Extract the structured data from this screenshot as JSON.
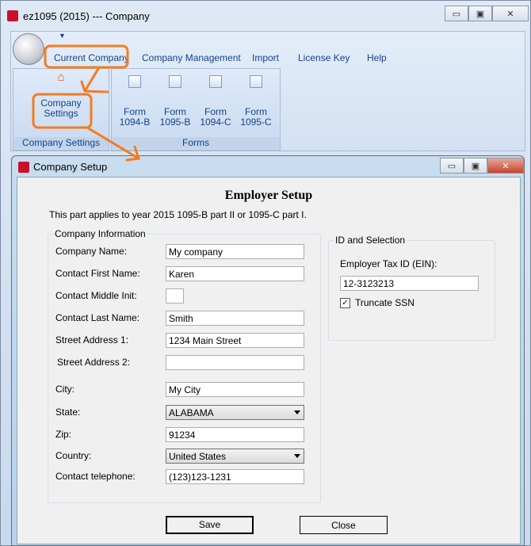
{
  "main_window": {
    "title": "ez1095 (2015) --- Company"
  },
  "ribbon": {
    "tabs": [
      "Current Company",
      "Company Management",
      "Import",
      "License Key",
      "Help"
    ],
    "groups": {
      "company_settings": {
        "label": "Company Settings",
        "button": [
          "Company",
          "Settings"
        ]
      },
      "forms": {
        "label": "Forms",
        "buttons": [
          [
            "Form",
            "1094-B"
          ],
          [
            "Form",
            "1095-B"
          ],
          [
            "Form",
            "1094-C"
          ],
          [
            "Form",
            "1095-C"
          ]
        ]
      }
    }
  },
  "dialog": {
    "title": "Company Setup",
    "heading": "Employer Setup",
    "subtitle": "This part applies to year 2015 1095-B part II or 1095-C part I.",
    "company_info": {
      "legend": "Company Information",
      "fields": [
        {
          "label": "Company Name:",
          "value": "My company"
        },
        {
          "label": "Contact First Name:",
          "value": "Karen"
        },
        {
          "label": "Contact Middle Init:",
          "value": ""
        },
        {
          "label": "Contact Last Name:",
          "value": "Smith"
        },
        {
          "label": "Street Address 1:",
          "value": "1234 Main Street"
        },
        {
          "label": "Street Address 2:",
          "value": ""
        },
        {
          "label": "City:",
          "value": "My City"
        },
        {
          "label": "State:",
          "value": "ALABAMA"
        },
        {
          "label": "Zip:",
          "value": "91234"
        },
        {
          "label": "Country:",
          "value": "United States"
        },
        {
          "label": "Contact telephone:",
          "value": "(123)123-1231"
        }
      ]
    },
    "id_selection": {
      "legend": "ID and Selection",
      "ein_label": "Employer Tax ID (EIN):",
      "ein_value": "12-3123213",
      "truncate_label": "Truncate SSN",
      "truncate_checked": true
    },
    "save_label": "Save",
    "close_label": "Close"
  },
  "colors": {
    "annotation": "#f47c20",
    "ribbon_text": "#15428b"
  }
}
